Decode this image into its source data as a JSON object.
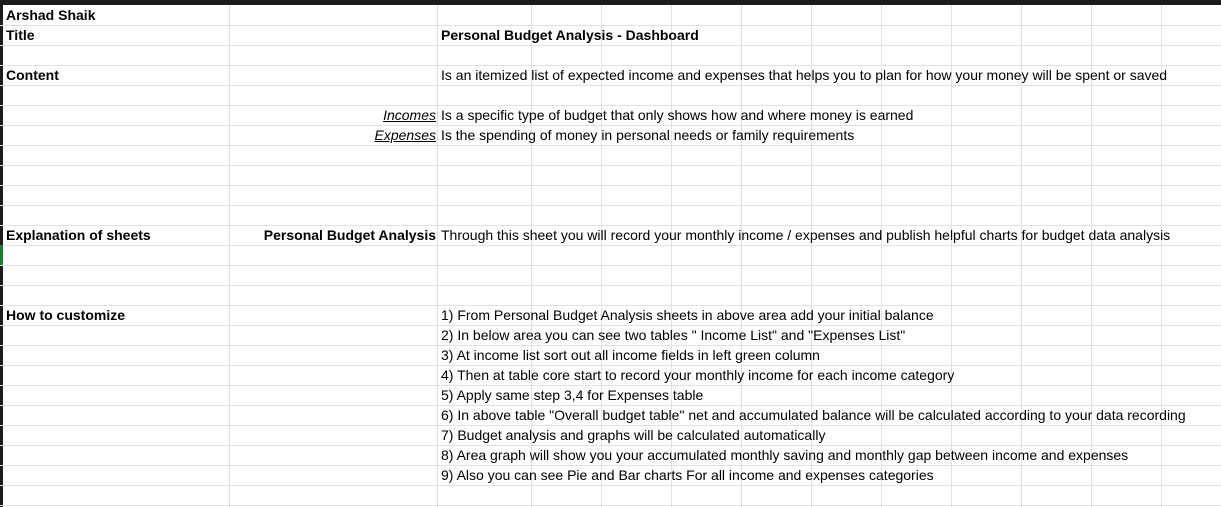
{
  "sheet": {
    "rows": [
      {
        "a": "Arshad Shaik",
        "bc": "",
        "d": ""
      },
      {
        "a": "Title",
        "bc": "",
        "d": "Personal Budget Analysis - Dashboard"
      },
      {
        "a": "",
        "bc": "",
        "d": ""
      },
      {
        "a": "Content",
        "bc": "",
        "d": "Is an itemized list of expected income and expenses that helps you to plan for how your money will be spent or saved"
      },
      {
        "a": "",
        "bc": "",
        "d": ""
      },
      {
        "a": "",
        "bc": "Incomes",
        "d": "Is a specific type of budget that only shows how and where money is earned"
      },
      {
        "a": "",
        "bc": "Expenses",
        "d": "Is the spending of money in personal needs or family requirements"
      },
      {
        "a": "",
        "bc": "",
        "d": ""
      },
      {
        "a": "",
        "bc": "",
        "d": ""
      },
      {
        "a": "",
        "bc": "",
        "d": ""
      },
      {
        "a": "",
        "bc": "",
        "d": ""
      },
      {
        "a": "Explanation of sheets",
        "bc": "Personal Budget Analysis",
        "d": "Through this sheet you will record your monthly income / expenses and publish helpful charts for budget data analysis"
      },
      {
        "a": "",
        "bc": "",
        "d": ""
      },
      {
        "a": "",
        "bc": "",
        "d": ""
      },
      {
        "a": "",
        "bc": "",
        "d": ""
      },
      {
        "a": "How to customize",
        "bc": "",
        "d": "1) From Personal Budget Analysis sheets in above area add your initial balance"
      },
      {
        "a": "",
        "bc": "",
        "d": "2) In below area you can see two tables \" Income List\" and \"Expenses List\""
      },
      {
        "a": "",
        "bc": "",
        "d": "3) At income list sort out all income fields in left green column"
      },
      {
        "a": "",
        "bc": "",
        "d": "4) Then at table core start to record your monthly income for each income category"
      },
      {
        "a": "",
        "bc": "",
        "d": "5) Apply same step 3,4 for Expenses table"
      },
      {
        "a": "",
        "bc": "",
        "d": "6) In above table \"Overall budget table\" net and accumulated balance will be calculated according to your data recording"
      },
      {
        "a": "",
        "bc": "",
        "d": "7) Budget analysis and graphs will be calculated automatically"
      },
      {
        "a": "",
        "bc": "",
        "d": "8) Area graph will show you your accumulated monthly saving and monthly gap between income and expenses"
      },
      {
        "a": "",
        "bc": "",
        "d": "9) Also you can see Pie and Bar charts For all income and expenses categories"
      }
    ]
  }
}
